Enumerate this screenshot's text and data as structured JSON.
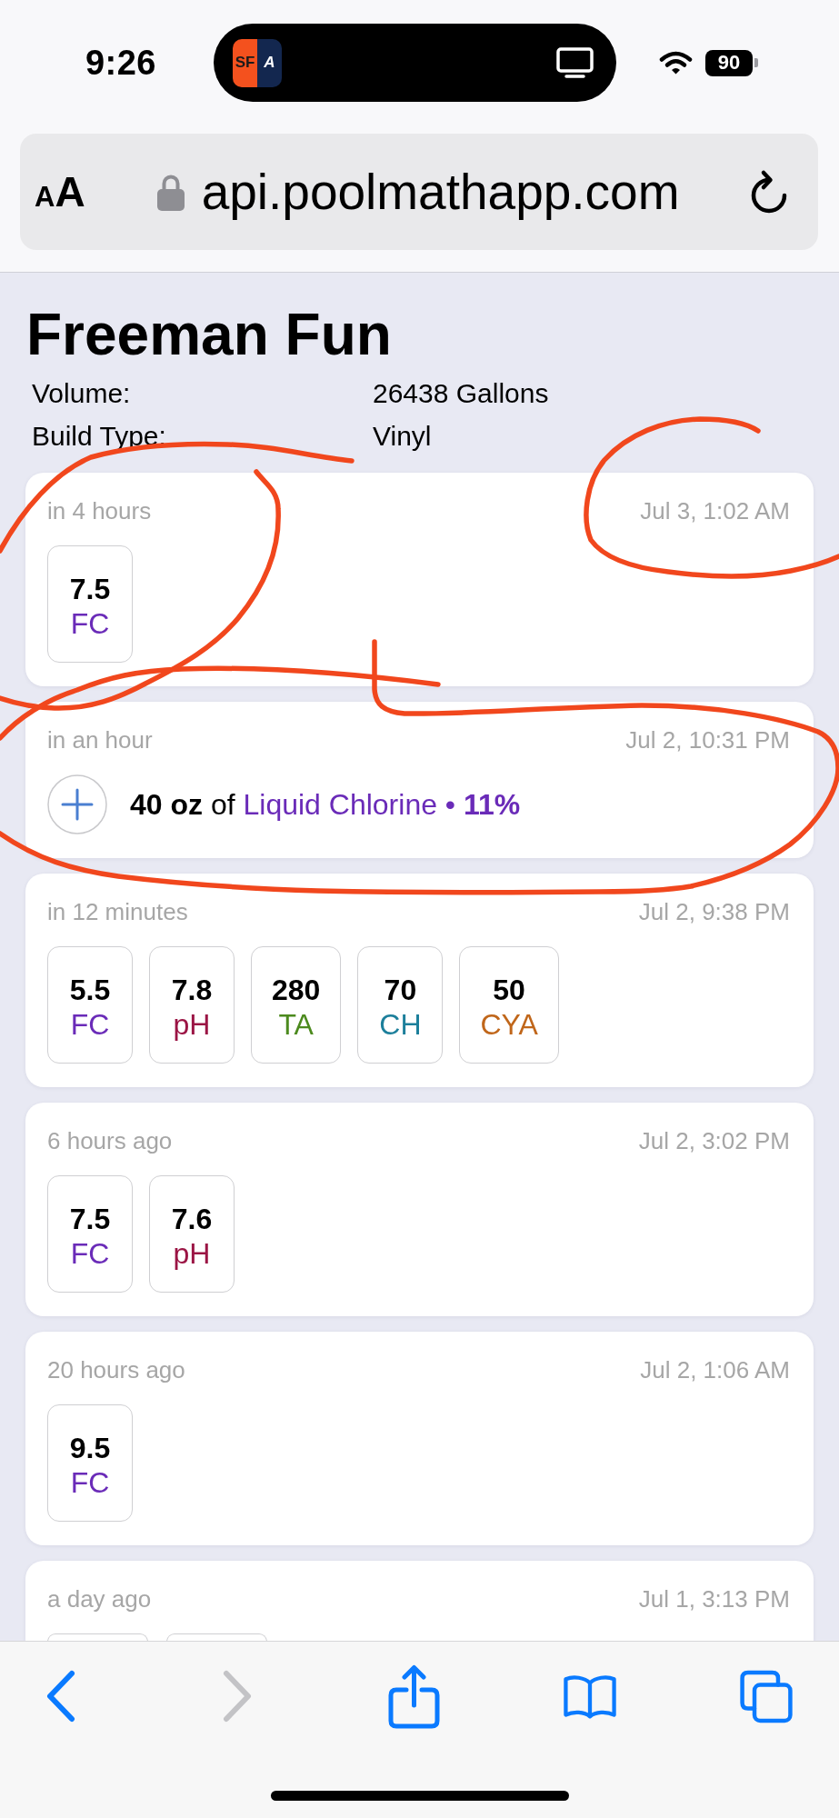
{
  "status_bar": {
    "time": "9:26",
    "live_activity": {
      "logo_left": "SF",
      "logo_right": "A"
    },
    "battery": "90"
  },
  "browser": {
    "text_size_button": {
      "small_letter": "A",
      "large_letter": "A"
    },
    "url": "api.poolmathapp.com"
  },
  "pool": {
    "name": "Freeman Fun",
    "details": [
      {
        "label": "Volume:",
        "value": "26438 Gallons"
      },
      {
        "label": "Build Type:",
        "value": "Vinyl"
      }
    ]
  },
  "log_entries": [
    {
      "kind": "readings",
      "relative_time": "in 4 hours",
      "date": "Jul 3, 1:02 AM",
      "readings": [
        {
          "kind": "chip",
          "value": "7.5",
          "parameter": "FC",
          "color": "#6a2bb8"
        }
      ]
    },
    {
      "kind": "addition",
      "relative_time": "in an hour",
      "date": "Jul 2, 10:31 PM",
      "addition": {
        "amount": "40 oz",
        "connector": "of",
        "chemical": "Liquid Chlorine",
        "separator": "•",
        "concentration": "11%"
      }
    },
    {
      "kind": "readings",
      "relative_time": "in 12 minutes",
      "date": "Jul 2, 9:38 PM",
      "readings": [
        {
          "kind": "chip",
          "value": "5.5",
          "parameter": "FC",
          "color": "#6a2bb8"
        },
        {
          "kind": "chip",
          "value": "7.8",
          "parameter": "pH",
          "color": "#9b1444"
        },
        {
          "kind": "chip",
          "value": "280",
          "parameter": "TA",
          "color": "#4c8a1e"
        },
        {
          "kind": "chip",
          "value": "70",
          "parameter": "CH",
          "color": "#1c7f9b"
        },
        {
          "kind": "chip",
          "value": "50",
          "parameter": "CYA",
          "color": "#c0661a"
        }
      ]
    },
    {
      "kind": "readings",
      "relative_time": "6 hours ago",
      "date": "Jul 2, 3:02 PM",
      "readings": [
        {
          "kind": "chip",
          "value": "7.5",
          "parameter": "FC",
          "color": "#6a2bb8"
        },
        {
          "kind": "chip",
          "value": "7.6",
          "parameter": "pH",
          "color": "#9b1444"
        }
      ]
    },
    {
      "kind": "readings",
      "relative_time": "20 hours ago",
      "date": "Jul 2, 1:06 AM",
      "readings": [
        {
          "kind": "chip",
          "value": "9.5",
          "parameter": "FC",
          "color": "#6a2bb8"
        }
      ]
    },
    {
      "kind": "readings",
      "relative_time": "a day ago",
      "date": "Jul 1, 3:13 PM",
      "readings": [
        {
          "kind": "covered"
        },
        {
          "kind": "covered"
        }
      ]
    }
  ],
  "toolbar": [
    {
      "kind": "back",
      "disabled": false
    },
    {
      "kind": "forward",
      "disabled": true
    },
    {
      "kind": "share",
      "disabled": false
    },
    {
      "kind": "bookmarks",
      "disabled": false
    },
    {
      "kind": "tabs",
      "disabled": false
    }
  ]
}
